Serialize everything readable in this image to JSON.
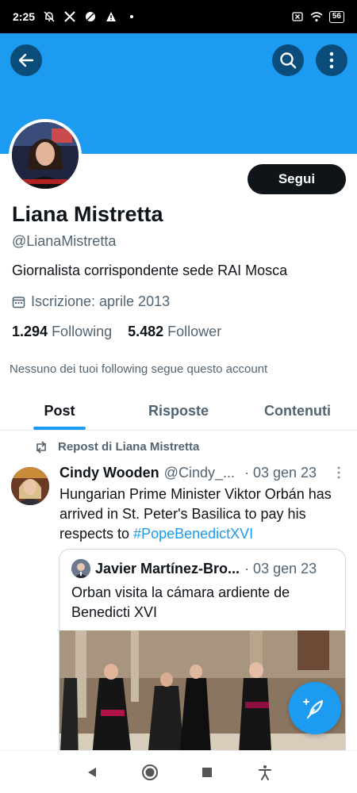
{
  "status_bar": {
    "time": "2:25",
    "battery": "56"
  },
  "profile": {
    "name": "Liana Mistretta",
    "handle": "@LianaMistretta",
    "bio": "Giornalista corrispondente sede RAI Mosca",
    "joined": "Iscrizione: aprile 2013",
    "following_count": "1.294",
    "following_label": "Following",
    "followers_count": "5.482",
    "followers_label": "Follower",
    "follow_button": "Segui",
    "mutual_note": "Nessuno dei tuoi following segue questo account"
  },
  "tabs": [
    {
      "label": "Post",
      "active": true
    },
    {
      "label": "Risposte",
      "active": false
    },
    {
      "label": "Contenuti",
      "active": false
    }
  ],
  "feed": {
    "repost_label": "Repost di Liana Mistretta",
    "tweet": {
      "author": "Cindy Wooden",
      "handle": "@Cindy_...",
      "date": "· 03 gen 23",
      "text": "Hungarian Prime Minister Viktor Orbán has arrived in St. Peter's Basilica to pay his respects to ",
      "hashtag": "#PopeBenedictXVI"
    },
    "quote": {
      "author": "Javier Martínez-Bro...",
      "date": "· 03 gen 23",
      "text": "Orban visita la cámara ardiente de Benedicti XVI"
    }
  },
  "colors": {
    "accent": "#1d9bf0",
    "banner": "#1d9bf0",
    "text": "#0f1419",
    "muted": "#536471"
  }
}
